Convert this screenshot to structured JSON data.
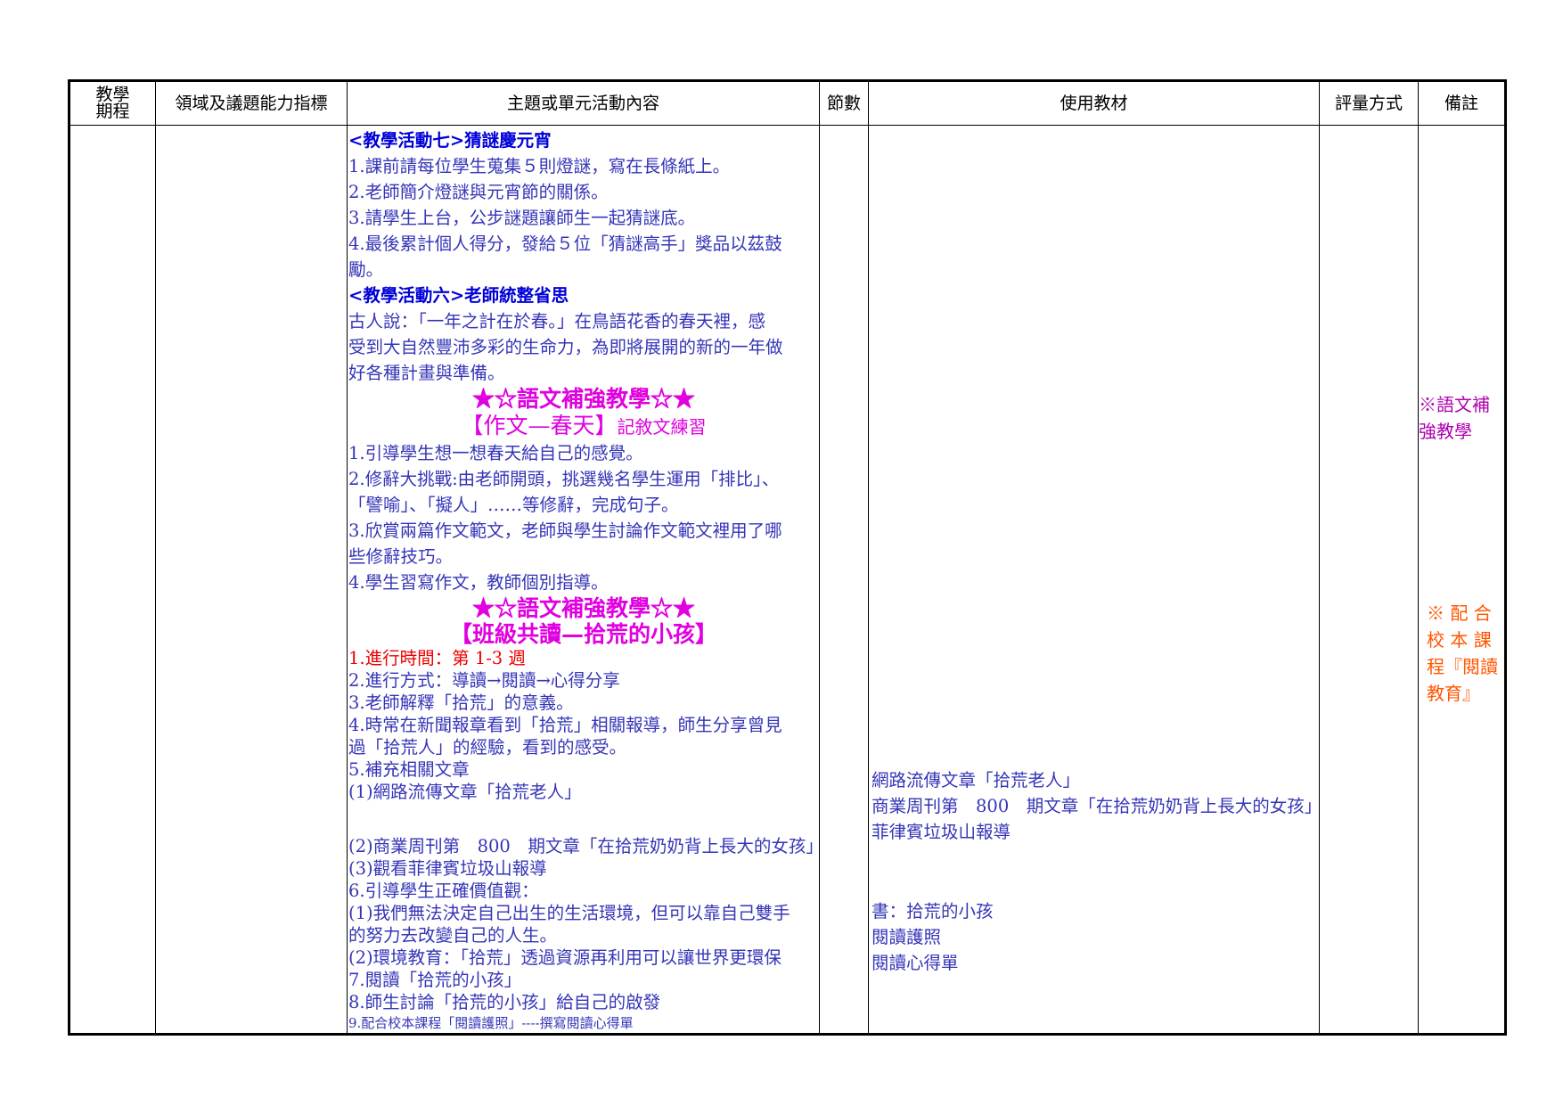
{
  "headers": {
    "period": "教學\n期程",
    "indicators": "領域及議題能力指標",
    "content": "主題或單元活動內容",
    "sessions": "節數",
    "materials": "使用教材",
    "assessment": "評量方式",
    "remarks": "備註"
  },
  "content": {
    "act7_title": "<教學活動七>猜謎慶元宵",
    "act7_l1": "1.課前請每位學生蒐集５則燈謎，寫在長條紙上。",
    "act7_l2": "2.老師簡介燈謎與元宵節的關係。",
    "act7_l3": "3.請學生上台，公步謎題讓師生一起猜謎底。",
    "act7_l4a": "4.最後累計個人得分，發給５位「猜謎高手」獎品以茲鼓",
    "act7_l4b": "勵。",
    "act6_title": "<教學活動六>老師統整省思",
    "act6_l1": "古人說：「一年之計在於春。」在鳥語花香的春天裡，感",
    "act6_l2": "受到大自然豐沛多彩的生命力，為即將展開的新的一年做",
    "act6_l3": "好各種計畫與準備。",
    "banner1": "★☆語文補強教學☆★",
    "essay_title": "【作文—春天】",
    "essay_type": "記敘文練習",
    "essay_l1": "1.引導學生想一想春天給自己的感覺。",
    "essay_l2a": "2.修辭大挑戰:由老師開頭，挑選幾名學生運用「排比」、",
    "essay_l2b": "「譬喻」、「擬人」……等修辭，完成句子。",
    "essay_l3a": "3.欣賞兩篇作文範文，老師與學生討論作文範文裡用了哪",
    "essay_l3b": "些修辭技巧。",
    "essay_l4": "4.學生習寫作文，教師個別指導。",
    "banner2": "★☆語文補強教學☆★",
    "reading_title": "【班級共讀—拾荒的小孩】",
    "read_time": "1.進行時間：第 1-3 週",
    "read_l2": "2.進行方式：導讀→閱讀→心得分享",
    "read_l3": "3.老師解釋「拾荒」的意義。",
    "read_l4a": "4.時常在新聞報章看到「拾荒」相關報導，師生分享曾見",
    "read_l4b": "過「拾荒人」的經驗，看到的感受。",
    "read_l5": "5.補充相關文章",
    "read_l5_1": "(1)網路流傳文章「拾荒老人」",
    "read_l5_2": "(2)商業周刊第　800　期文章「在拾荒奶奶背上長大的女孩」",
    "read_l5_3": "(3)觀看菲律賓垃圾山報導",
    "read_l6": "6.引導學生正確價值觀：",
    "read_l6_1a": "(1)我們無法決定自己出生的生活環境，但可以靠自己雙手",
    "read_l6_1b": "的努力去改變自己的人生。",
    "read_l6_2": "(2)環境教育：「拾荒」透過資源再利用可以讓世界更環保",
    "read_l7": "7.閱讀「拾荒的小孩」",
    "read_l8": "8.師生討論「拾荒的小孩」給自己的啟發",
    "read_l9": "9.配合校本課程「閱讀護照」----撰寫閱讀心得單"
  },
  "materials": {
    "m1": "網路流傳文章「拾荒老人」",
    "m2": "商業周刊第　800　期文章「在拾荒奶奶背上長大的女孩」",
    "m3": "菲律賓垃圾山報導",
    "m4": "書：拾荒的小孩",
    "m5": "閱讀護照",
    "m6": "閱讀心得單"
  },
  "remarks": {
    "r1a": "※語文補",
    "r1b": "強教學",
    "r2a": "※ 配 合",
    "r2b": "校 本 課",
    "r2c": "程『閱讀",
    "r2d": "教育』"
  },
  "colors": {
    "blue_text": "#3535b8",
    "activity_title": "#0000d8",
    "banner": "#e000e0",
    "highlight_red": "#ee0000",
    "remark_purple": "#b000b0",
    "remark_orange": "#ff5500"
  }
}
